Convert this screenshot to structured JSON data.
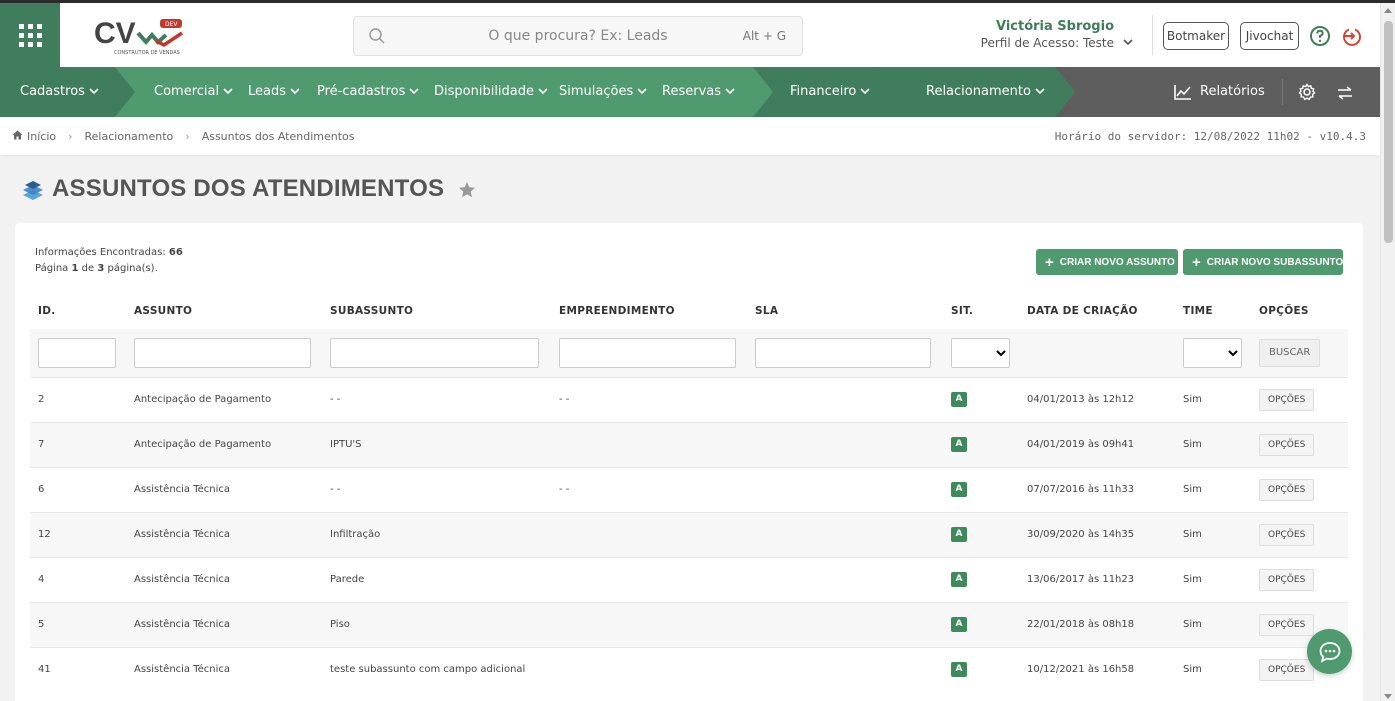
{
  "header": {
    "search_placeholder": "O que procura? Ex: Leads",
    "search_shortcut": "Alt + G",
    "user_name": "Victória Sbrogio",
    "user_profile": "Perfil de Acesso: Teste",
    "botmaker_label": "Botmaker",
    "jivochat_label": "Jivochat",
    "logo_text": "CV",
    "logo_badge": "DEV",
    "logo_subtitle": "CONSTRUTOR DE VENDAS"
  },
  "nav": {
    "items": [
      {
        "label": "Cadastros"
      },
      {
        "label": "Comercial"
      },
      {
        "label": "Leads"
      },
      {
        "label": "Pré-cadastros"
      },
      {
        "label": "Disponibilidade"
      },
      {
        "label": "Simulações"
      },
      {
        "label": "Reservas"
      },
      {
        "label": "Financeiro"
      },
      {
        "label": "Relacionamento"
      }
    ],
    "reports_label": "Relatórios",
    "colors": {
      "green": "#3f7d5c",
      "green_light": "#4f9a6f",
      "grey": "#5e5e5e"
    }
  },
  "breadcrumb": {
    "items": [
      "Início",
      "Relacionamento",
      "Assuntos dos Atendimentos"
    ],
    "server_time": "Horário do servidor: 12/08/2022 11h02 - v10.4.3"
  },
  "page": {
    "title": "ASSUNTOS DOS ATENDIMENTOS",
    "info_found_label": "Informações Encontradas:",
    "info_found_count": "66",
    "info_page_prefix": "Página",
    "info_page_current": "1",
    "info_page_of": "de",
    "info_page_total": "3",
    "info_page_suffix": "página(s).",
    "btn_new_subject": "CRIAR NOVO ASSUNTO",
    "btn_new_subsubject": "CRIAR NOVO SUBASSUNTO",
    "btn_search": "BUSCAR"
  },
  "table": {
    "columns": [
      "ID.",
      "ASSUNTO",
      "SUBASSUNTO",
      "EMPREENDIMENTO",
      "SLA",
      "SIT.",
      "DATA DE CRIAÇÃO",
      "TIME",
      "OPÇÕES"
    ],
    "options_label": "OPÇÕES",
    "rows": [
      {
        "id": "2",
        "assunto": "Antecipação de Pagamento",
        "subassunto": "- -",
        "empreendimento": "- -",
        "sla": "",
        "sit": "A",
        "data": "04/01/2013 às 12h12",
        "time": "Sim"
      },
      {
        "id": "7",
        "assunto": "Antecipação de Pagamento",
        "subassunto": "IPTU'S",
        "empreendimento": "",
        "sla": "",
        "sit": "A",
        "data": "04/01/2019 às 09h41",
        "time": "Sim"
      },
      {
        "id": "6",
        "assunto": "Assistência Técnica",
        "subassunto": "- -",
        "empreendimento": "- -",
        "sla": "",
        "sit": "A",
        "data": "07/07/2016 às 11h33",
        "time": "Sim"
      },
      {
        "id": "12",
        "assunto": "Assistência Técnica",
        "subassunto": "Infiltração",
        "empreendimento": "",
        "sla": "",
        "sit": "A",
        "data": "30/09/2020 às 14h35",
        "time": "Sim"
      },
      {
        "id": "4",
        "assunto": "Assistência Técnica",
        "subassunto": "Parede",
        "empreendimento": "",
        "sla": "",
        "sit": "A",
        "data": "13/06/2017 às 11h23",
        "time": "Sim"
      },
      {
        "id": "5",
        "assunto": "Assistência Técnica",
        "subassunto": "Piso",
        "empreendimento": "",
        "sla": "",
        "sit": "A",
        "data": "22/01/2018 às 08h18",
        "time": "Sim"
      },
      {
        "id": "41",
        "assunto": "Assistência Técnica",
        "subassunto": "teste subassunto com campo adicional",
        "empreendimento": "",
        "sla": "",
        "sit": "A",
        "data": "10/12/2021 às 16h58",
        "time": "Sim"
      }
    ]
  }
}
